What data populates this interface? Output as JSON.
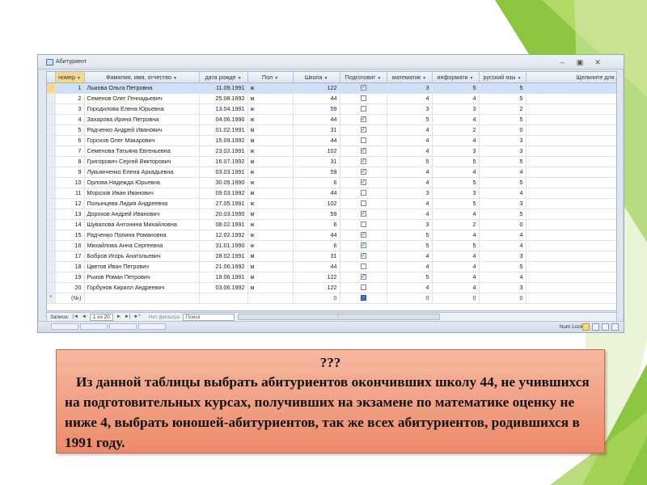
{
  "window": {
    "title": "Абитуриент",
    "controls": {
      "minimize": "–",
      "restore": "▣",
      "close": "✕"
    }
  },
  "columns": [
    {
      "label": "номер",
      "selected": true
    },
    {
      "label": "Фамилия, имя, отчество"
    },
    {
      "label": "дата рожде"
    },
    {
      "label": "Пол"
    },
    {
      "label": "Школа"
    },
    {
      "label": "Подготовит"
    },
    {
      "label": "математик"
    },
    {
      "label": "информати"
    },
    {
      "label": "русский язы"
    },
    {
      "label": "Щелкните для добавл"
    }
  ],
  "rows": [
    {
      "num": "1",
      "fio": "Лыкова Ольга Петровна",
      "date": "11.09.1991",
      "sex": "ж",
      "school": "122",
      "prep": true,
      "math": "3",
      "inf": "5",
      "rus": "5"
    },
    {
      "num": "2",
      "fio": "Семенов Олег Геннадьевич",
      "date": "25.08.1992",
      "sex": "м",
      "school": "44",
      "prep": false,
      "math": "4",
      "inf": "4",
      "rus": "5"
    },
    {
      "num": "3",
      "fio": "Городилова Елена Юрьевна",
      "date": "13.04.1991",
      "sex": "ж",
      "school": "59",
      "prep": false,
      "math": "3",
      "inf": "3",
      "rus": "2"
    },
    {
      "num": "4",
      "fio": "Захарова Ирина Петровна",
      "date": "04.06.1990",
      "sex": "ж",
      "school": "44",
      "prep": true,
      "math": "5",
      "inf": "4",
      "rus": "5"
    },
    {
      "num": "5",
      "fio": "Радченко Андрей Иванович",
      "date": "01.02.1991",
      "sex": "м",
      "school": "31",
      "prep": true,
      "math": "4",
      "inf": "2",
      "rus": "0"
    },
    {
      "num": "6",
      "fio": "Горохов Олег Макарович",
      "date": "15.09.1992",
      "sex": "м",
      "school": "44",
      "prep": false,
      "math": "4",
      "inf": "4",
      "rus": "3"
    },
    {
      "num": "7",
      "fio": "Семенова Татьяна Евгеньевна",
      "date": "23.02.1991",
      "sex": "ж",
      "school": "102",
      "prep": true,
      "math": "4",
      "inf": "3",
      "rus": "3"
    },
    {
      "num": "8",
      "fio": "Григорович Сергей Викторович",
      "date": "16.07.1992",
      "sex": "м",
      "school": "31",
      "prep": true,
      "math": "5",
      "inf": "5",
      "rus": "5"
    },
    {
      "num": "9",
      "fio": "Лукьянченко Елена Аркадьевна",
      "date": "03.03.1991",
      "sex": "ж",
      "school": "59",
      "prep": true,
      "math": "4",
      "inf": "4",
      "rus": "4"
    },
    {
      "num": "10",
      "fio": "Орлова Надежда Юрьевна",
      "date": "30.09.1990",
      "sex": "ж",
      "school": "6",
      "prep": true,
      "math": "4",
      "inf": "5",
      "rus": "5"
    },
    {
      "num": "11",
      "fio": "Морозов Иван Иванович",
      "date": "09.03.1992",
      "sex": "м",
      "school": "44",
      "prep": false,
      "math": "3",
      "inf": "3",
      "rus": "4"
    },
    {
      "num": "12",
      "fio": "Полынцева Лидия Андреевна",
      "date": "27.05.1991",
      "sex": "ж",
      "school": "102",
      "prep": false,
      "math": "4",
      "inf": "5",
      "rus": "3"
    },
    {
      "num": "13",
      "fio": "Дорохов Андрей Иванович",
      "date": "20.03.1990",
      "sex": "м",
      "school": "59",
      "prep": true,
      "math": "4",
      "inf": "4",
      "rus": "5"
    },
    {
      "num": "14",
      "fio": "Шувалова Антонина Михайловна",
      "date": "08.02.1991",
      "sex": "ж",
      "school": "6",
      "prep": false,
      "math": "3",
      "inf": "2",
      "rus": "0"
    },
    {
      "num": "15",
      "fio": "Радченко Полина Романовна",
      "date": "12.02.1992",
      "sex": "ж",
      "school": "44",
      "prep": true,
      "math": "5",
      "inf": "4",
      "rus": "4"
    },
    {
      "num": "16",
      "fio": "Михайлова Анна Сергеевна",
      "date": "31.01.1990",
      "sex": "ж",
      "school": "6",
      "prep": true,
      "math": "5",
      "inf": "5",
      "rus": "4"
    },
    {
      "num": "17",
      "fio": "Бобров Игорь Анатольевич",
      "date": "28.02.1991",
      "sex": "м",
      "school": "31",
      "prep": true,
      "math": "4",
      "inf": "4",
      "rus": "3"
    },
    {
      "num": "18",
      "fio": "Цветов Иван Петрович",
      "date": "21.06.1992",
      "sex": "м",
      "school": "44",
      "prep": false,
      "math": "4",
      "inf": "4",
      "rus": "5"
    },
    {
      "num": "19",
      "fio": "Рыков Роман Петрович",
      "date": "19.06.1991",
      "sex": "м",
      "school": "122",
      "prep": true,
      "math": "5",
      "inf": "4",
      "rus": "4"
    },
    {
      "num": "20",
      "fio": "Горбунов Кирилл Андреевич",
      "date": "03.06.1992",
      "sex": "м",
      "school": "122",
      "prep": false,
      "math": "4",
      "inf": "4",
      "rus": "3"
    }
  ],
  "new_row": {
    "marker": "*",
    "num": "(№)",
    "school": "0",
    "math": "0",
    "inf": "0",
    "rus": "0"
  },
  "navbar": {
    "records_label": "Записи:",
    "first": "|◄",
    "prev": "◄",
    "position": "1 из 20",
    "next": "►",
    "last": "►|",
    "new": "►*",
    "filter": "Нет фильтра",
    "search": "Поиск"
  },
  "statusbar": {
    "numlock": "Num Lock"
  },
  "task": {
    "q": "???",
    "text": "Из данной таблицы выбрать абитуриентов окончивших школу 44, не учившихся на подготовительных курсах, получивших на экзамене по математике оценку не ниже 4, выбрать юношей-абитуриентов,  так же всех абитуриентов, родившихся в 1991 году."
  },
  "colors": {
    "slide_green": "#8cc63f",
    "task_box": "#ec8a6a",
    "row_highlight": "#cfe0f6"
  }
}
